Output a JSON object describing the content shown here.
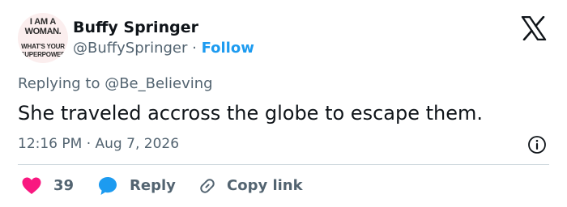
{
  "avatar": {
    "lines": [
      "I AM A",
      "WOMAN.",
      "WHAT'S YOUR",
      "SUPERPOWER"
    ]
  },
  "author": {
    "name": "Buffy Springer",
    "handle": "@BuffySpringer",
    "separator": "·",
    "follow_label": "Follow"
  },
  "reply_context": "Replying to @Be_Believing",
  "tweet_text": "She traveled accross the globe to escape them.",
  "timestamp": "12:16 PM · Aug 7, 2026",
  "actions": {
    "like_count": "39",
    "reply_label": "Reply",
    "copy_label": "Copy link"
  },
  "colors": {
    "accent": "#1d9bf0",
    "like": "#f91880",
    "muted": "#536471",
    "text": "#0f1419"
  },
  "icons": {
    "brand": "x-logo-icon",
    "info": "info-icon",
    "like": "heart-icon",
    "reply": "speech-bubble-icon",
    "copy": "link-icon"
  }
}
